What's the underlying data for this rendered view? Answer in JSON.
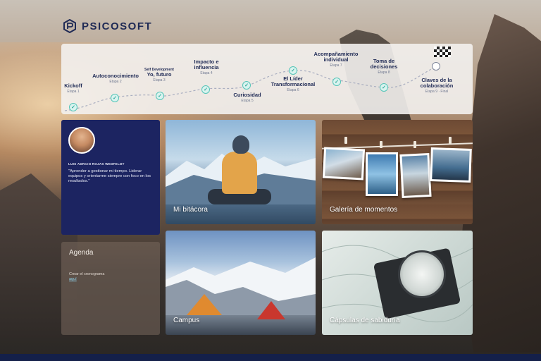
{
  "brand": {
    "name": "PSICOSOFT"
  },
  "roadmap": {
    "stages": [
      {
        "title": "Kickoff",
        "sub": "Etapa 1"
      },
      {
        "title": "Autoconocimiento",
        "sub": "Etapa 2"
      },
      {
        "title_small": "Self Development",
        "title": "Yo, futuro",
        "sub": "Etapa 3"
      },
      {
        "title": "Impacto e influencia",
        "sub": "Etapa 4"
      },
      {
        "title": "Curiosidad",
        "sub": "Etapa 5"
      },
      {
        "title": "El Líder Transformacional",
        "sub": "Etapa 6"
      },
      {
        "title": "Acompañamiento individual",
        "sub": "Etapa 7"
      },
      {
        "title": "Toma de decisiones",
        "sub": "Etapa 8"
      },
      {
        "title": "Claves de la colaboración",
        "sub": "Etapa 9 · Final"
      }
    ]
  },
  "profile": {
    "name": "LUIS ADRIAN ROJAS WEDFELDT",
    "quote": "\"Aprender a gestionar mi tiempo. Liderar equipos y orientarme siempre con foco en los resultados.\""
  },
  "agenda": {
    "title": "Agenda",
    "text": "Crear el cronograma",
    "link": "aquí"
  },
  "tiles": {
    "bitacora": "Mi bitácora",
    "galeria": "Galería de momentos",
    "campus": "Campus",
    "capsulas": "Cápsulas de sabiduría"
  },
  "colors": {
    "navy": "#1c2461",
    "brand_text": "#1f2a55",
    "check_teal": "#55c5b8",
    "footer": "#14204a"
  }
}
